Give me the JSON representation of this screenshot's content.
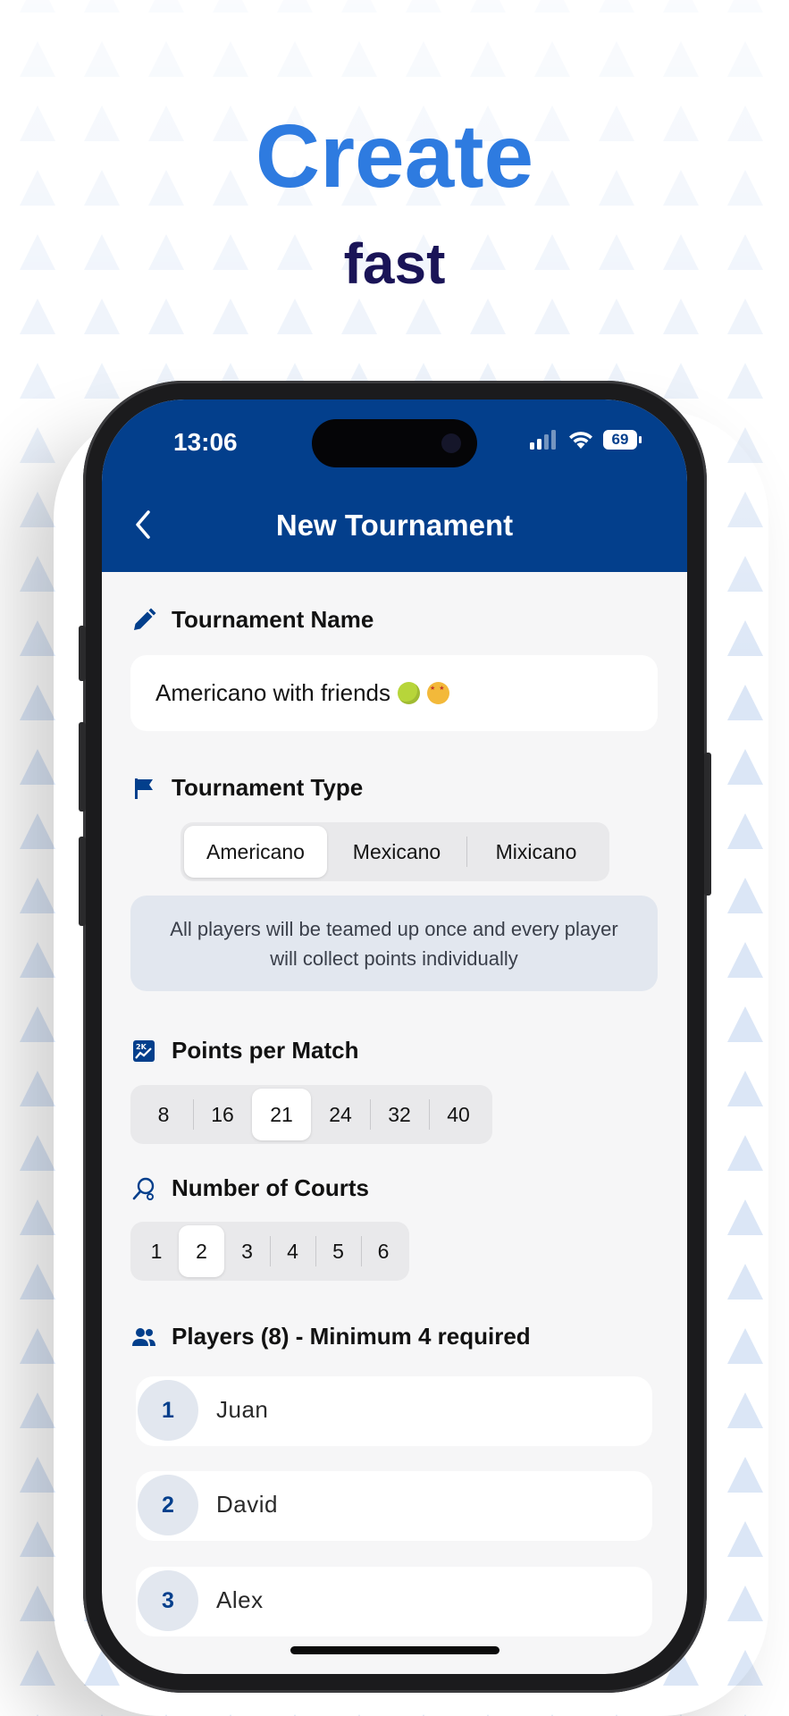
{
  "hero": {
    "title": "Create",
    "subtitle": "fast"
  },
  "status_bar": {
    "time": "13:06",
    "battery": "69"
  },
  "nav": {
    "title": "New Tournament",
    "back_icon": "chevron-left-icon"
  },
  "tournament_name": {
    "label": "Tournament Name",
    "icon": "pencil-icon",
    "value": "Americano with friends"
  },
  "tournament_type": {
    "label": "Tournament Type",
    "icon": "flag-icon",
    "options": [
      "Americano",
      "Mexicano",
      "Mixicano"
    ],
    "selected": "Americano",
    "description": "All players will be teamed up once and every player will collect points individually"
  },
  "points_per_match": {
    "label": "Points per Match",
    "icon": "score-chart-icon",
    "options": [
      "8",
      "16",
      "21",
      "24",
      "32",
      "40"
    ],
    "selected": "21"
  },
  "courts": {
    "label": "Number of Courts",
    "icon": "racket-icon",
    "options": [
      "1",
      "2",
      "3",
      "4",
      "5",
      "6"
    ],
    "selected": "2"
  },
  "players": {
    "label": "Players (8) - Minimum 4 required",
    "icon": "people-icon",
    "list": [
      {
        "number": "1",
        "name": "Juan"
      },
      {
        "number": "2",
        "name": "David"
      },
      {
        "number": "3",
        "name": "Alex"
      }
    ]
  },
  "colors": {
    "brand": "#033f8c",
    "accent": "#2e7be0",
    "subtitle": "#1a1457"
  }
}
